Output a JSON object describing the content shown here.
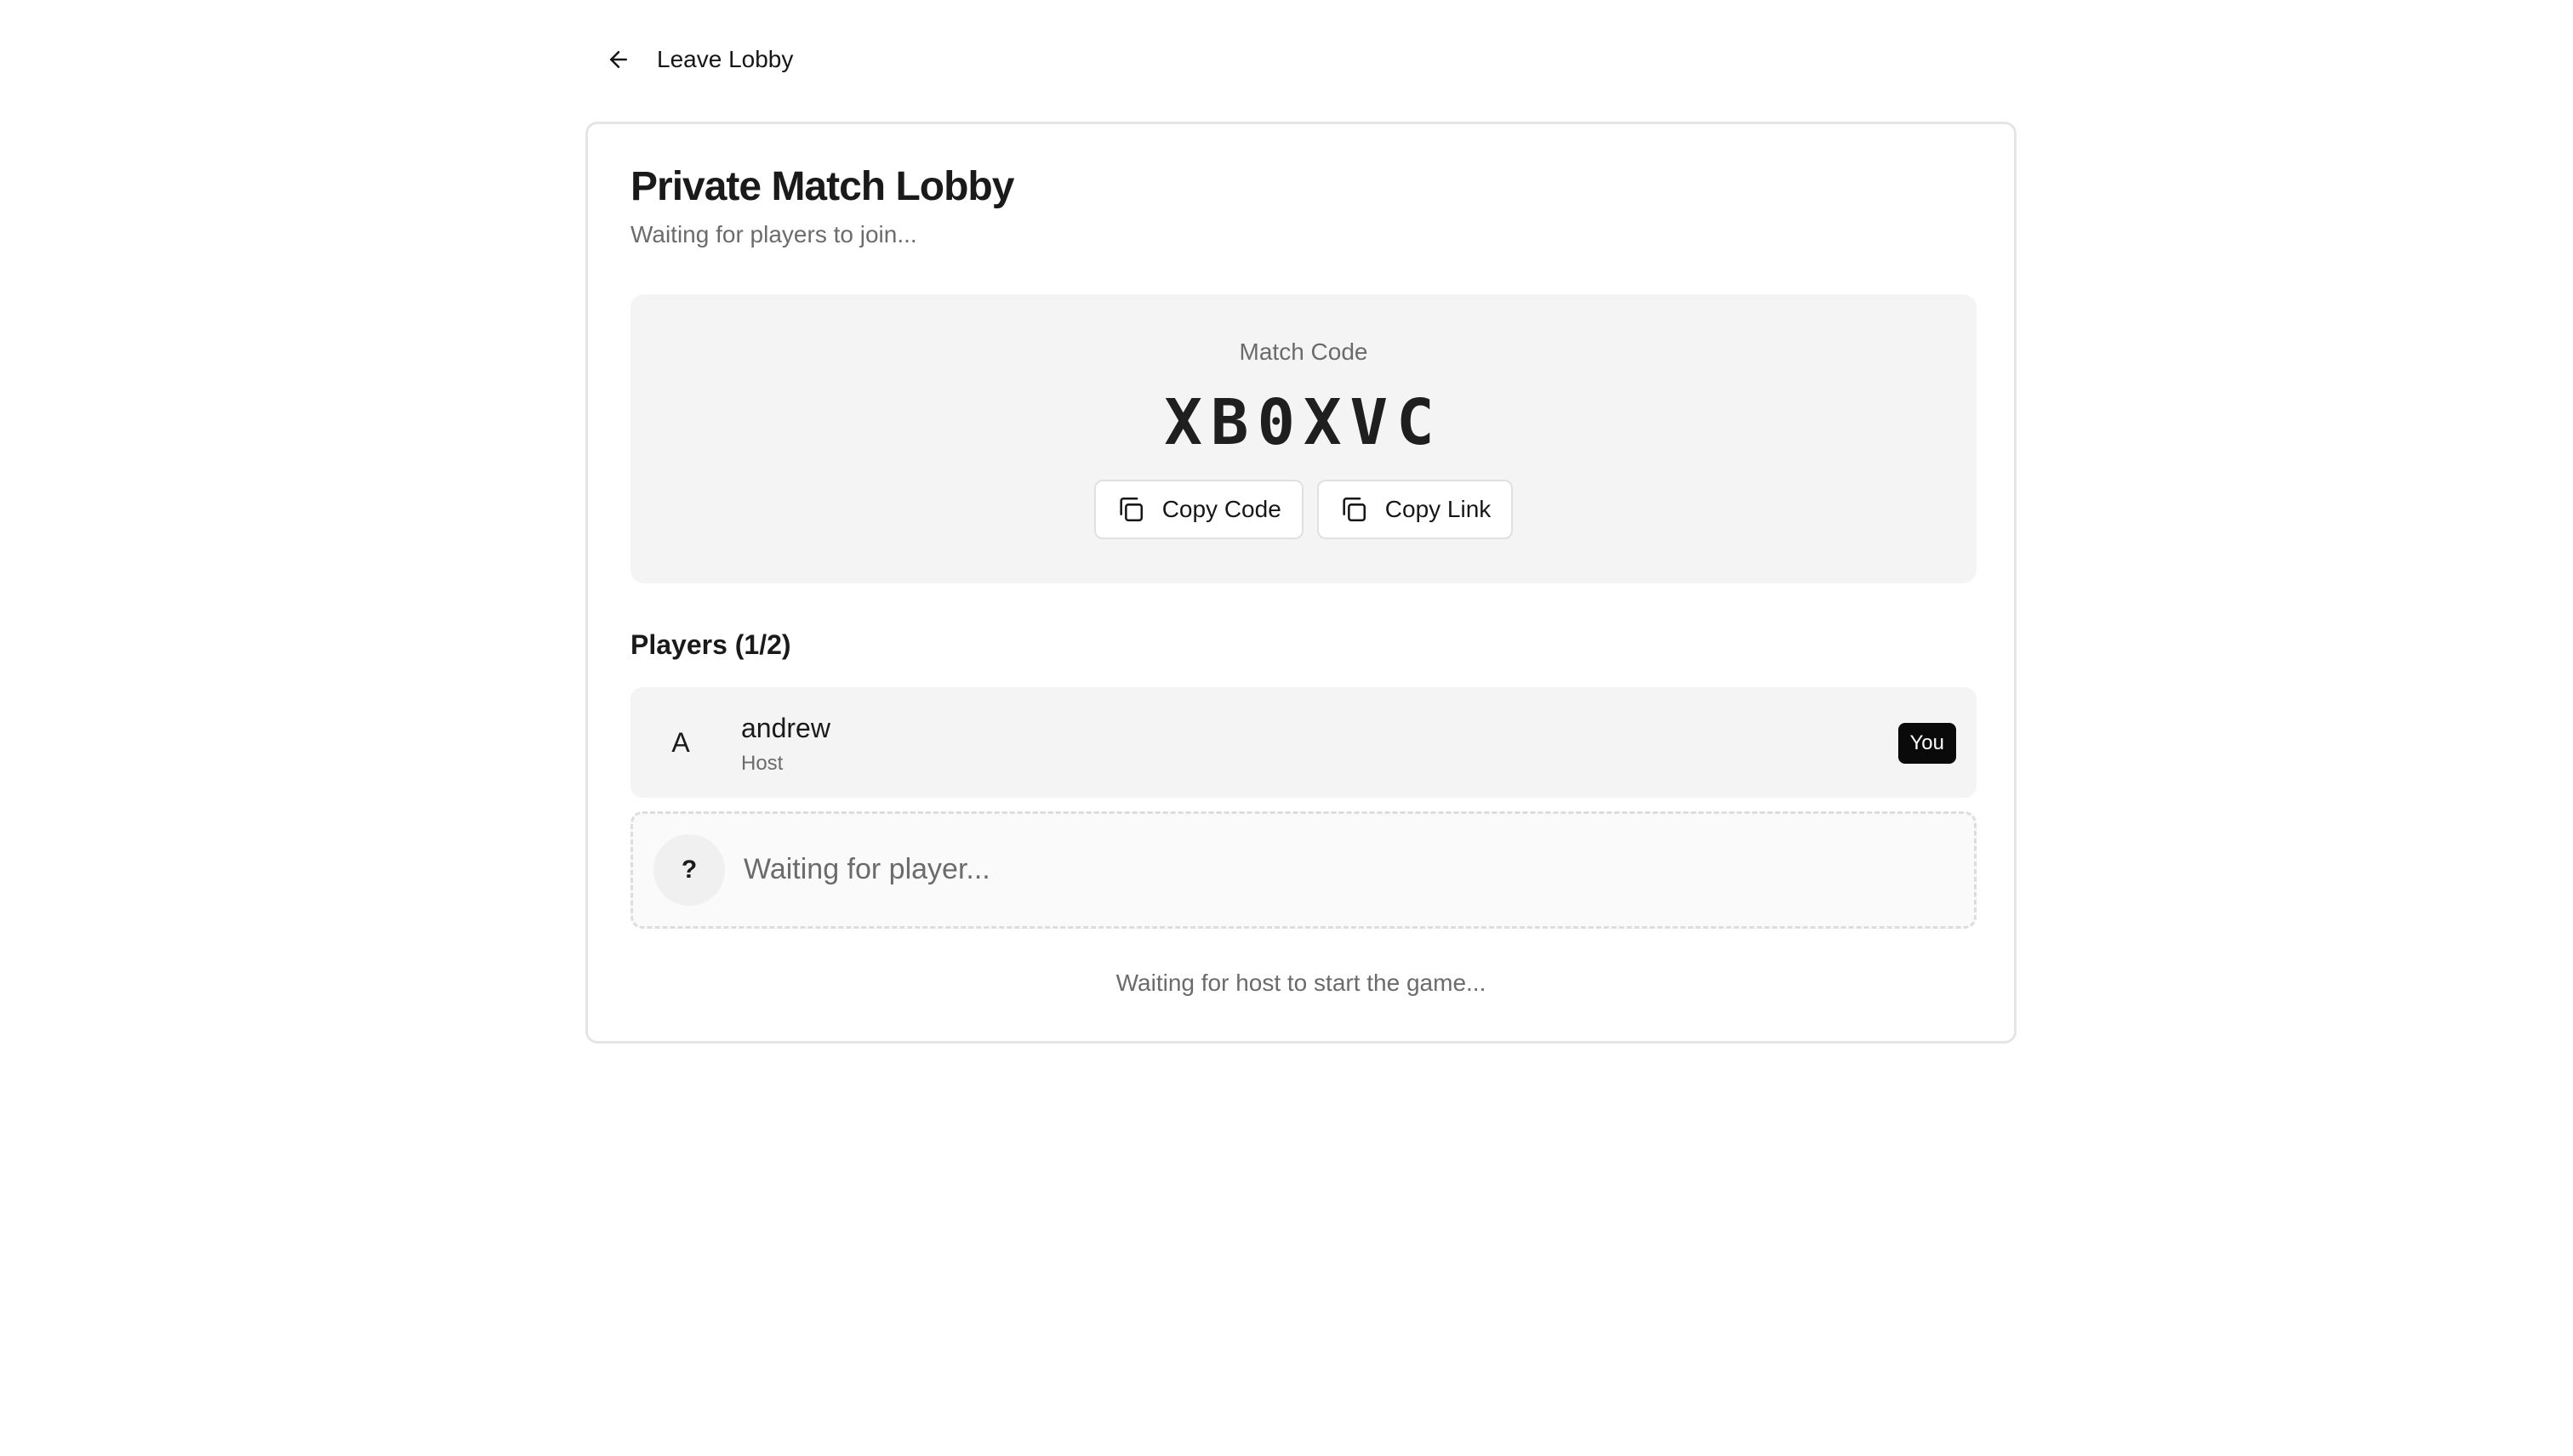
{
  "nav": {
    "back_label": "Leave Lobby",
    "back_icon": "arrow-left-icon"
  },
  "lobby": {
    "title": "Private Match Lobby",
    "subtitle": "Waiting for players to join...",
    "match_code_label": "Match Code",
    "match_code": "XB0XVC",
    "copy_code_label": "Copy Code",
    "copy_link_label": "Copy Link",
    "copy_icon": "copy-icon"
  },
  "players": {
    "heading": "Players (1/2)",
    "list": [
      {
        "initial": "A",
        "name": "andrew",
        "role": "Host",
        "badge": "You"
      }
    ],
    "empty_slot": {
      "initial": "?",
      "text": "Waiting for player..."
    }
  },
  "status": {
    "message": "Waiting for host to start the game..."
  },
  "colors": {
    "badge_bg": "#0a0a0a",
    "panel_bg": "#f4f4f4",
    "muted_text": "#6b6b6b"
  }
}
